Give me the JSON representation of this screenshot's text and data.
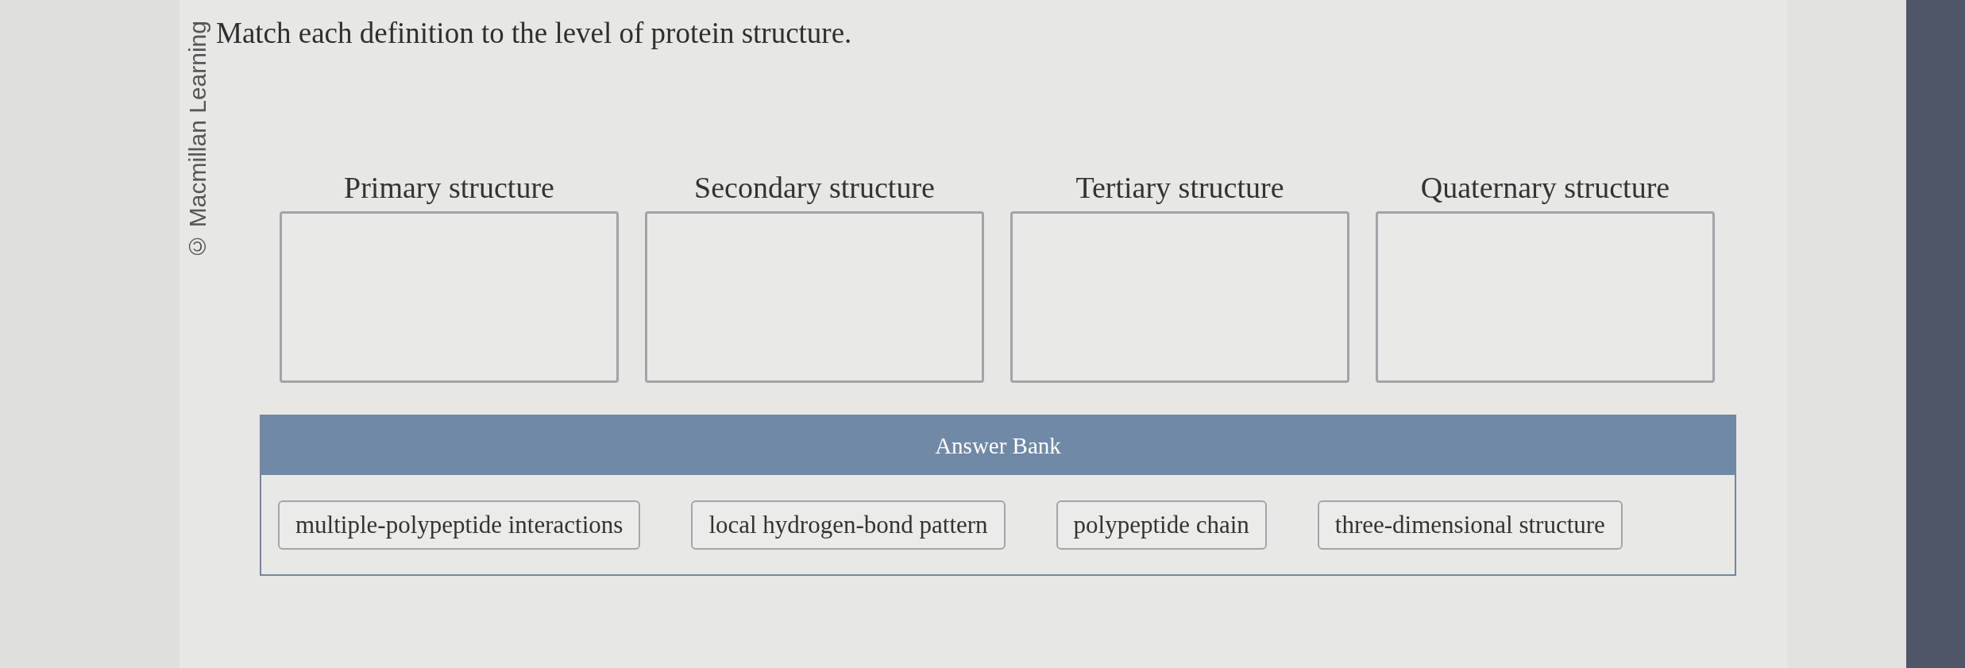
{
  "credit": "© Macmillan Learning",
  "prompt": "Match each definition to the level of protein structure.",
  "targets": [
    {
      "label": "Primary structure"
    },
    {
      "label": "Secondary structure"
    },
    {
      "label": "Tertiary structure"
    },
    {
      "label": "Quaternary structure"
    }
  ],
  "answer_bank": {
    "title": "Answer Bank",
    "items": [
      "multiple-polypeptide interactions",
      "local hydrogen-bond pattern",
      "polypeptide chain",
      "three-dimensional structure"
    ]
  }
}
